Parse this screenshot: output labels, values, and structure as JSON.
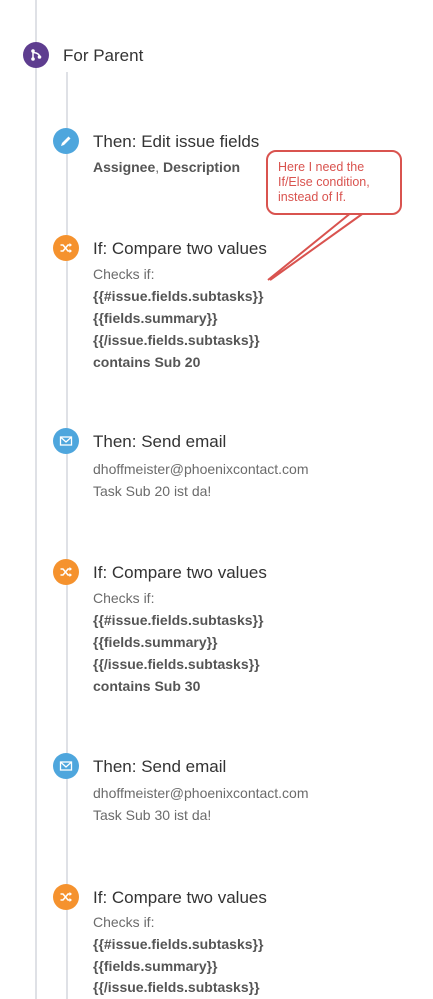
{
  "parent": {
    "title": "For Parent"
  },
  "steps": [
    {
      "title": "Then: Edit issue fields",
      "fields": [
        {
          "text": "Assignee"
        },
        {
          "text": ", "
        },
        {
          "text": "Description"
        }
      ]
    },
    {
      "title": "If: Compare two values",
      "lines": [
        "Checks if:",
        "{{#issue.fields.subtasks}}",
        "{{fields.summary}}",
        "{{/issue.fields.subtasks}}",
        "contains Sub 20"
      ]
    },
    {
      "title": "Then: Send email",
      "lines": [
        "dhoffmeister@phoenixcontact.com",
        "Task Sub 20 ist da!"
      ]
    },
    {
      "title": "If: Compare two values",
      "lines": [
        "Checks if:",
        "{{#issue.fields.subtasks}}",
        "{{fields.summary}}",
        "{{/issue.fields.subtasks}}",
        "contains Sub 30"
      ]
    },
    {
      "title": "Then: Send email",
      "lines": [
        "dhoffmeister@phoenixcontact.com",
        "Task Sub 30 ist da!"
      ]
    },
    {
      "title": "If: Compare two values",
      "lines": [
        "Checks if:",
        "{{#issue.fields.subtasks}}",
        "{{fields.summary}}",
        "{{/issue.fields.subtasks}}"
      ]
    }
  ],
  "callout": {
    "lines": [
      "Here I need the",
      "If/Else condition,",
      "instead of If."
    ]
  },
  "colors": {
    "branch": "#5e3d8f",
    "action": "#4ea6dd",
    "condition": "#f5922e",
    "annotation": "#d9534f"
  },
  "icons": {
    "branch": "branch-icon",
    "edit": "pencil-icon",
    "email": "envelope-icon",
    "condition": "shuffle-icon"
  }
}
